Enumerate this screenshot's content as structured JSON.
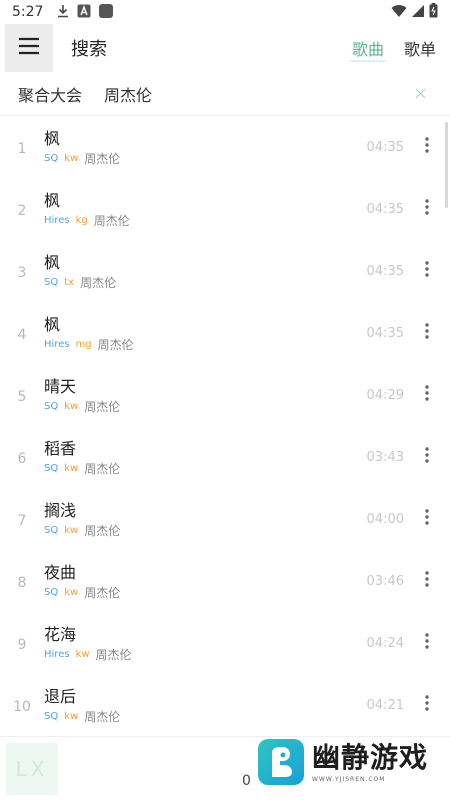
{
  "status_bar": {
    "time": "5:27",
    "left_icons": [
      "download-icon",
      "a-icon",
      "app-square-icon"
    ],
    "right_icons": [
      "wifi-icon",
      "signal-icon",
      "battery-icon"
    ]
  },
  "top_bar": {
    "title": "搜索",
    "tabs": [
      {
        "label": "歌曲",
        "active": true
      },
      {
        "label": "歌单",
        "active": false
      }
    ],
    "accent_color": "#5ab48c"
  },
  "query": {
    "source": "聚合大会",
    "text": "周杰伦"
  },
  "results": [
    {
      "index": "1",
      "name": "枫",
      "quality": "SQ",
      "source": "kw",
      "artist": "周杰伦",
      "duration": "04:35"
    },
    {
      "index": "2",
      "name": "枫",
      "quality": "Hires",
      "source": "kg",
      "artist": "周杰伦",
      "duration": "04:35"
    },
    {
      "index": "3",
      "name": "枫",
      "quality": "SQ",
      "source": "tx",
      "artist": "周杰伦",
      "duration": "04:35"
    },
    {
      "index": "4",
      "name": "枫",
      "quality": "Hires",
      "source": "mg",
      "artist": "周杰伦",
      "duration": "04:35"
    },
    {
      "index": "5",
      "name": "晴天",
      "quality": "SQ",
      "source": "kw",
      "artist": "周杰伦",
      "duration": "04:29"
    },
    {
      "index": "6",
      "name": "稻香",
      "quality": "SQ",
      "source": "kw",
      "artist": "周杰伦",
      "duration": "03:43"
    },
    {
      "index": "7",
      "name": "搁浅",
      "quality": "SQ",
      "source": "kw",
      "artist": "周杰伦",
      "duration": "04:00"
    },
    {
      "index": "8",
      "name": "夜曲",
      "quality": "SQ",
      "source": "kw",
      "artist": "周杰伦",
      "duration": "03:46"
    },
    {
      "index": "9",
      "name": "花海",
      "quality": "Hires",
      "source": "kw",
      "artist": "周杰伦",
      "duration": "04:24"
    },
    {
      "index": "10",
      "name": "退后",
      "quality": "SQ",
      "source": "kw",
      "artist": "周杰伦",
      "duration": "04:21"
    }
  ],
  "player": {
    "logo_text": "LX",
    "count": "0"
  },
  "watermark": {
    "title": "幽静游戏",
    "url": "WWW.YJISREN.COM"
  },
  "colors": {
    "quality_tag": "#4aa8e0",
    "source_tag": "#f0a030"
  }
}
